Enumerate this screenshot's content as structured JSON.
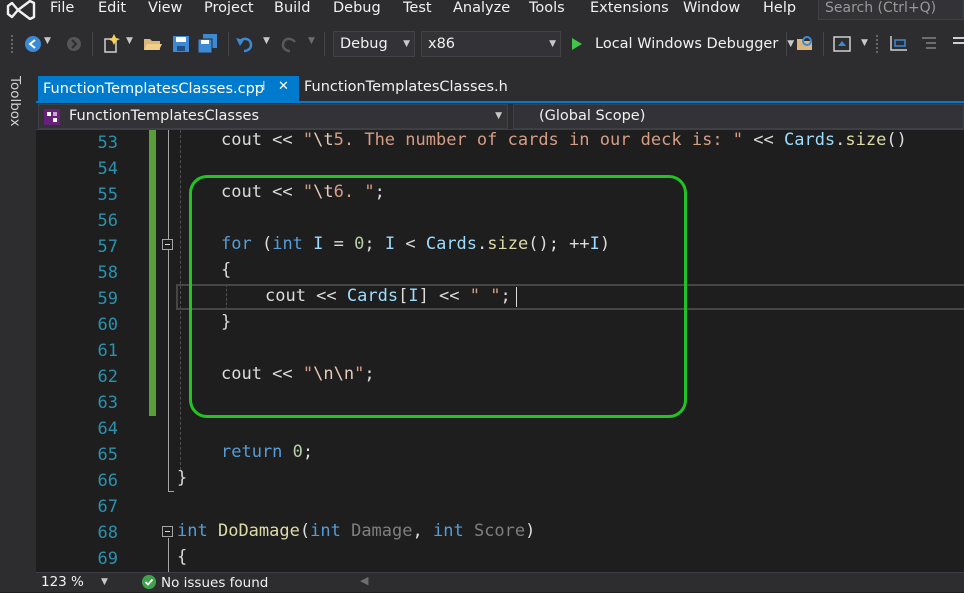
{
  "menu": [
    "File",
    "Edit",
    "View",
    "Project",
    "Build",
    "Debug",
    "Test",
    "Analyze",
    "Tools",
    "Extensions",
    "Window",
    "Help"
  ],
  "search": {
    "placeholder": "Search (Ctrl+Q)"
  },
  "toolbar": {
    "configuration": "Debug",
    "platform": "x86",
    "run_label": "Local Windows Debugger"
  },
  "toolbox_label": "Toolbox",
  "tabs": [
    {
      "label": "FunctionTemplatesClasses.cpp",
      "active": true,
      "pin": "⊣",
      "close": "✕"
    },
    {
      "label": "FunctionTemplatesClasses.h",
      "active": false
    }
  ],
  "nav": {
    "class_scope": "FunctionTemplatesClasses",
    "member_scope": "(Global Scope)"
  },
  "editor": {
    "line_numbers": [
      "53",
      "54",
      "55",
      "56",
      "57",
      "58",
      "59",
      "60",
      "61",
      "62",
      "63",
      "64",
      "65",
      "66",
      "67",
      "68",
      "69"
    ],
    "code": {
      "l53": [
        "cout << ",
        "\"",
        "\\t",
        "5. The number of cards in our deck is: \"",
        " << ",
        "Cards",
        ".",
        "size",
        "()"
      ],
      "l55": [
        "cout << ",
        "\"",
        "\\t",
        "6. \"",
        ";"
      ],
      "l57": [
        "for",
        " (",
        "int",
        " ",
        "I",
        " = ",
        "0",
        "; ",
        "I",
        " < ",
        "Cards",
        ".",
        "size",
        "(); ++",
        "I",
        ")"
      ],
      "l58": "{",
      "l59": [
        "cout << ",
        "Cards",
        "[",
        "I",
        "] << ",
        "\" \"",
        ";"
      ],
      "l60": "}",
      "l62": [
        "cout << ",
        "\"",
        "\\n\\n",
        "\"",
        ";"
      ],
      "l65": [
        "return",
        " ",
        "0",
        ";"
      ],
      "l66": "}",
      "l68": [
        "int",
        " ",
        "DoDamage",
        "(",
        "int",
        " ",
        "Damage",
        ", ",
        "int",
        " ",
        "Score",
        ")"
      ],
      "l69": "{"
    },
    "highlight_color": "#22c322"
  },
  "status": {
    "zoom": "123 %",
    "issues": "No issues found"
  },
  "colors": {
    "accent": "#007acc",
    "chrome": "#2d2d30",
    "editor_bg": "#1e1e1e"
  }
}
